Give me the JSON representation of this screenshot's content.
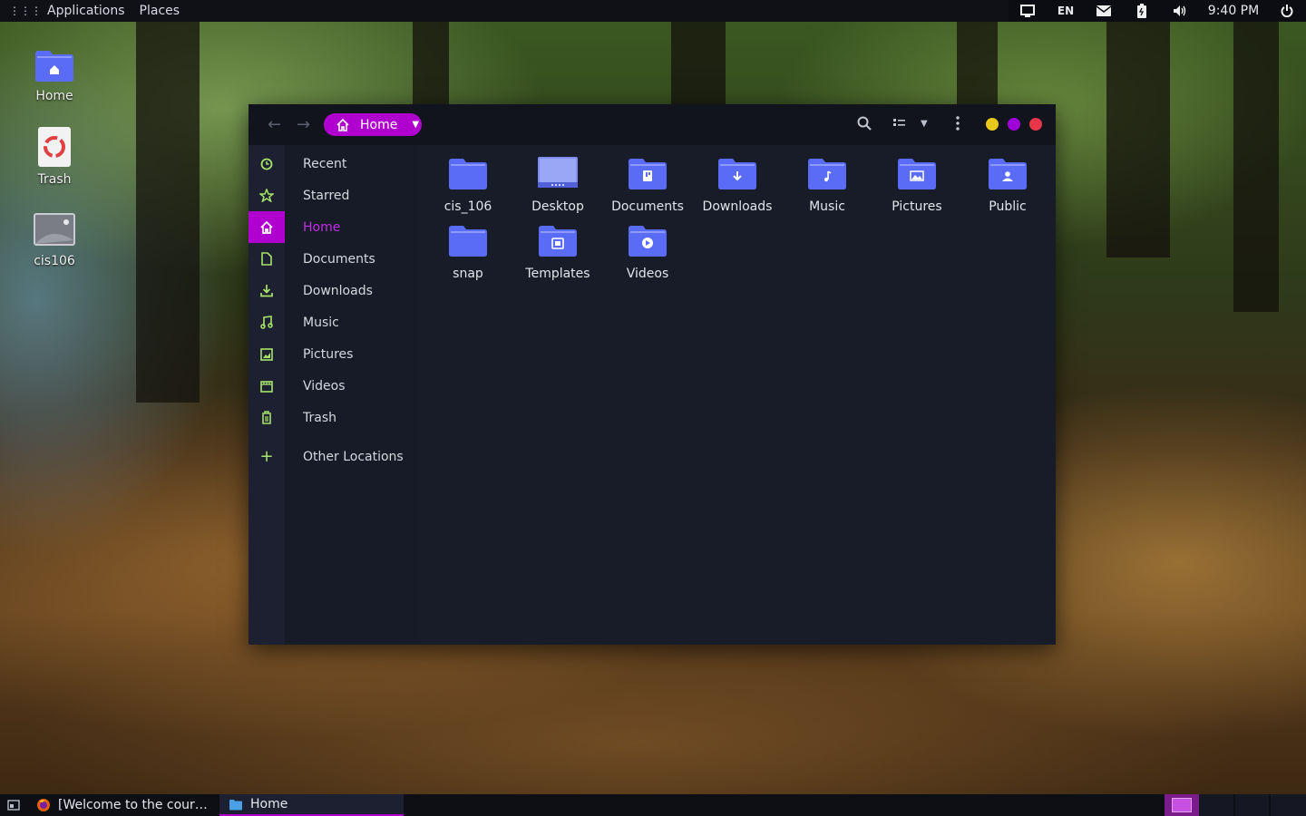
{
  "topbar": {
    "applications_label": "Applications",
    "places_label": "Places",
    "language": "EN",
    "clock": "9:40 PM"
  },
  "desktop_icons": [
    {
      "label": "Home"
    },
    {
      "label": "Trash"
    },
    {
      "label": "cis106"
    }
  ],
  "window": {
    "breadcrumb_label": "Home",
    "sidebar": [
      {
        "label": "Recent",
        "icon": "clock-icon"
      },
      {
        "label": "Starred",
        "icon": "star-icon"
      },
      {
        "label": "Home",
        "icon": "home-icon",
        "active": true
      },
      {
        "label": "Documents",
        "icon": "document-icon"
      },
      {
        "label": "Downloads",
        "icon": "download-icon"
      },
      {
        "label": "Music",
        "icon": "music-icon"
      },
      {
        "label": "Pictures",
        "icon": "picture-icon"
      },
      {
        "label": "Videos",
        "icon": "video-icon"
      },
      {
        "label": "Trash",
        "icon": "trash-icon"
      },
      {
        "label": "Other Locations",
        "icon": "plus-icon"
      }
    ],
    "files": [
      {
        "name": "cis_106",
        "icon": "folder-icon"
      },
      {
        "name": "Desktop",
        "icon": "desktop-folder-icon"
      },
      {
        "name": "Documents",
        "icon": "documents-folder-icon"
      },
      {
        "name": "Downloads",
        "icon": "downloads-folder-icon"
      },
      {
        "name": "Music",
        "icon": "music-folder-icon"
      },
      {
        "name": "Pictures",
        "icon": "pictures-folder-icon"
      },
      {
        "name": "Public",
        "icon": "public-folder-icon"
      },
      {
        "name": "snap",
        "icon": "folder-icon"
      },
      {
        "name": "Templates",
        "icon": "templates-folder-icon"
      },
      {
        "name": "Videos",
        "icon": "videos-folder-icon"
      }
    ],
    "window_controls": [
      "minimize",
      "maximize",
      "close"
    ]
  },
  "taskbar": {
    "tasks": [
      {
        "label": "[Welcome to the cour…",
        "icon": "firefox-icon"
      },
      {
        "label": "Home",
        "icon": "files-icon",
        "active": true
      }
    ]
  },
  "colors": {
    "accent": "#b000cf",
    "folder": "#5a6cf5",
    "sidebar_icon": "#a7e36a",
    "minimize": "#e8c81a",
    "maximize": "#a000d8",
    "close": "#e8364a"
  }
}
